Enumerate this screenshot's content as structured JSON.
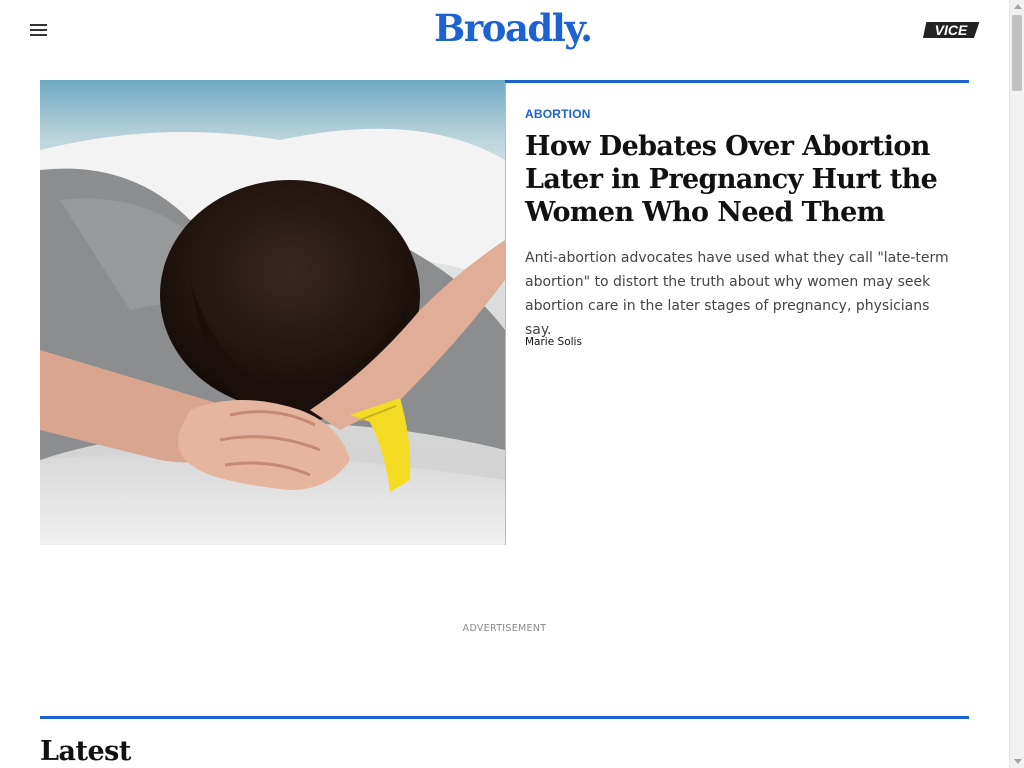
{
  "header": {
    "menu_icon": "hamburger-menu-icon",
    "logo_text": "Broadly.",
    "vice_logo_text": "VICE",
    "brand_color": "#1c63d1"
  },
  "hero": {
    "image_alt": "Woman lying on a hospital bed with a yellow wristband",
    "category": "ABORTION",
    "headline": "How Debates Over Abortion Later in Pregnancy Hurt the Women Who Need Them",
    "dek": "Anti-abortion advocates have used what they call \"late-term abortion\" to distort the truth about why women may seek abortion care in the later stages of pregnancy, physicians say.",
    "byline": "Marie Solis"
  },
  "ad": {
    "label": "ADVERTISEMENT"
  },
  "latest": {
    "title": "Latest"
  }
}
